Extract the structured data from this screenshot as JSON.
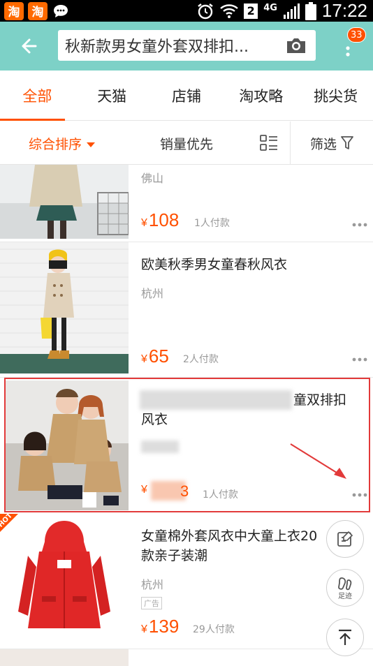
{
  "status_bar": {
    "app1_label": "淘",
    "app2_label": "淘",
    "sim_slot": "2",
    "network": "4G",
    "time": "17:22",
    "icons": [
      "taobao-app-icon",
      "chat-icon",
      "alarm-icon",
      "wifi-icon",
      "signal-icon",
      "battery-icon"
    ]
  },
  "header": {
    "search_query": "秋新款男女童外套双排扣...",
    "badge_count": "33",
    "accent_color": "#7dd1c7",
    "icons": [
      "back-arrow-icon",
      "camera-icon",
      "more-vertical-icon"
    ]
  },
  "tabs": [
    {
      "label": "全部",
      "active": true
    },
    {
      "label": "天猫",
      "active": false
    },
    {
      "label": "店铺",
      "active": false
    },
    {
      "label": "淘攻略",
      "active": false
    },
    {
      "label": "挑尖货",
      "active": false
    }
  ],
  "sort_bar": {
    "default_sort": "综合排序",
    "sales_sort": "销量优先",
    "filter_label": "筛选",
    "icons": [
      "layout-toggle-icon",
      "filter-icon",
      "caret-down-icon"
    ]
  },
  "products": [
    {
      "title": "",
      "location": "佛山",
      "price_symbol": "¥",
      "price": "108",
      "paid": "1人付款"
    },
    {
      "title": "欧美秋季男女童春秋风衣",
      "location": "杭州",
      "price_symbol": "¥",
      "price": "65",
      "paid": "2人付款"
    },
    {
      "title_suffix_line1": "童双排扣",
      "title_line2": "风衣",
      "price_symbol": "¥",
      "price_visible": "3",
      "paid": "1人付款"
    },
    {
      "title_line1": "女童棉外套风衣中大童上衣20",
      "title_line2": "款亲子装潮",
      "location": "杭州",
      "ad_label": "广告",
      "price_symbol": "¥",
      "price": "139",
      "paid": "29人付款",
      "hot_label": "HOT"
    }
  ],
  "floating_buttons": {
    "footprint_label": "足迹",
    "icons": [
      "edit-note-icon",
      "footprint-icon",
      "back-to-top-icon"
    ]
  },
  "colors": {
    "accent_orange": "#ff5000",
    "highlight_red": "#e23a3a"
  }
}
